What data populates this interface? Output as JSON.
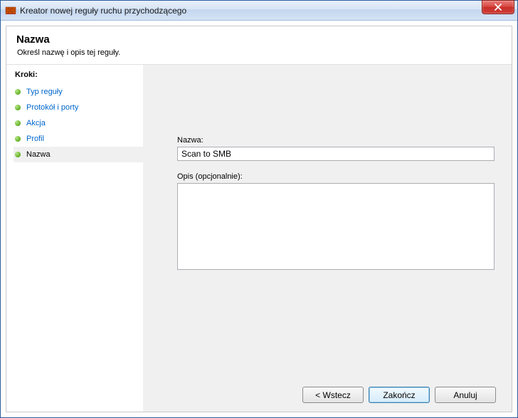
{
  "window": {
    "title": "Kreator nowej reguły ruchu przychodzącego"
  },
  "header": {
    "title": "Nazwa",
    "subtitle": "Określ nazwę i opis tej reguły."
  },
  "sidebar": {
    "steps_label": "Kroki:",
    "items": [
      {
        "label": "Typ reguły"
      },
      {
        "label": "Protokół i porty"
      },
      {
        "label": "Akcja"
      },
      {
        "label": "Profil"
      },
      {
        "label": "Nazwa"
      }
    ]
  },
  "form": {
    "name_label": "Nazwa:",
    "name_value": "Scan to SMB",
    "desc_label": "Opis (opcjonalnie):",
    "desc_value": ""
  },
  "buttons": {
    "back": "< Wstecz",
    "finish": "Zakończ",
    "cancel": "Anuluj"
  }
}
